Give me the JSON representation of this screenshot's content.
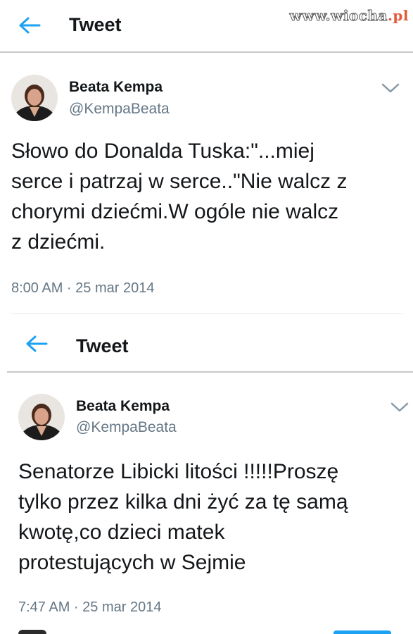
{
  "watermark": {
    "main": "www.wiocha",
    "tld": ".pl"
  },
  "screens": [
    {
      "header": {
        "title": "Tweet"
      },
      "tweet": {
        "display_name": "Beata Kempa",
        "handle": "@KempaBeata",
        "lines": [
          "Słowo do Donalda Tuska:\"...miej",
          "serce i patrzaj w serce..\"Nie walcz z",
          "chorymi dziećmi.W ogóle nie walcz",
          "z dziećmi."
        ],
        "timestamp": "8:00 AM · 25 mar 2014"
      }
    },
    {
      "header": {
        "title": "Tweet"
      },
      "tweet": {
        "display_name": "Beata Kempa",
        "handle": "@KempaBeata",
        "lines": [
          "Senatorze Libicki litości !!!!!Proszę",
          "tylko przez kilka dni żyć za tę samą",
          "kwotę,co dzieci matek",
          "protestujących w Sejmie"
        ],
        "timestamp": "7:47 AM · 25 mar 2014"
      }
    }
  ],
  "colors": {
    "accent": "#1da1f2",
    "text": "#14171a",
    "secondary": "#657786",
    "divider": "#c9c9c9"
  },
  "icons": [
    "back-arrow-icon",
    "chevron-down-icon"
  ]
}
